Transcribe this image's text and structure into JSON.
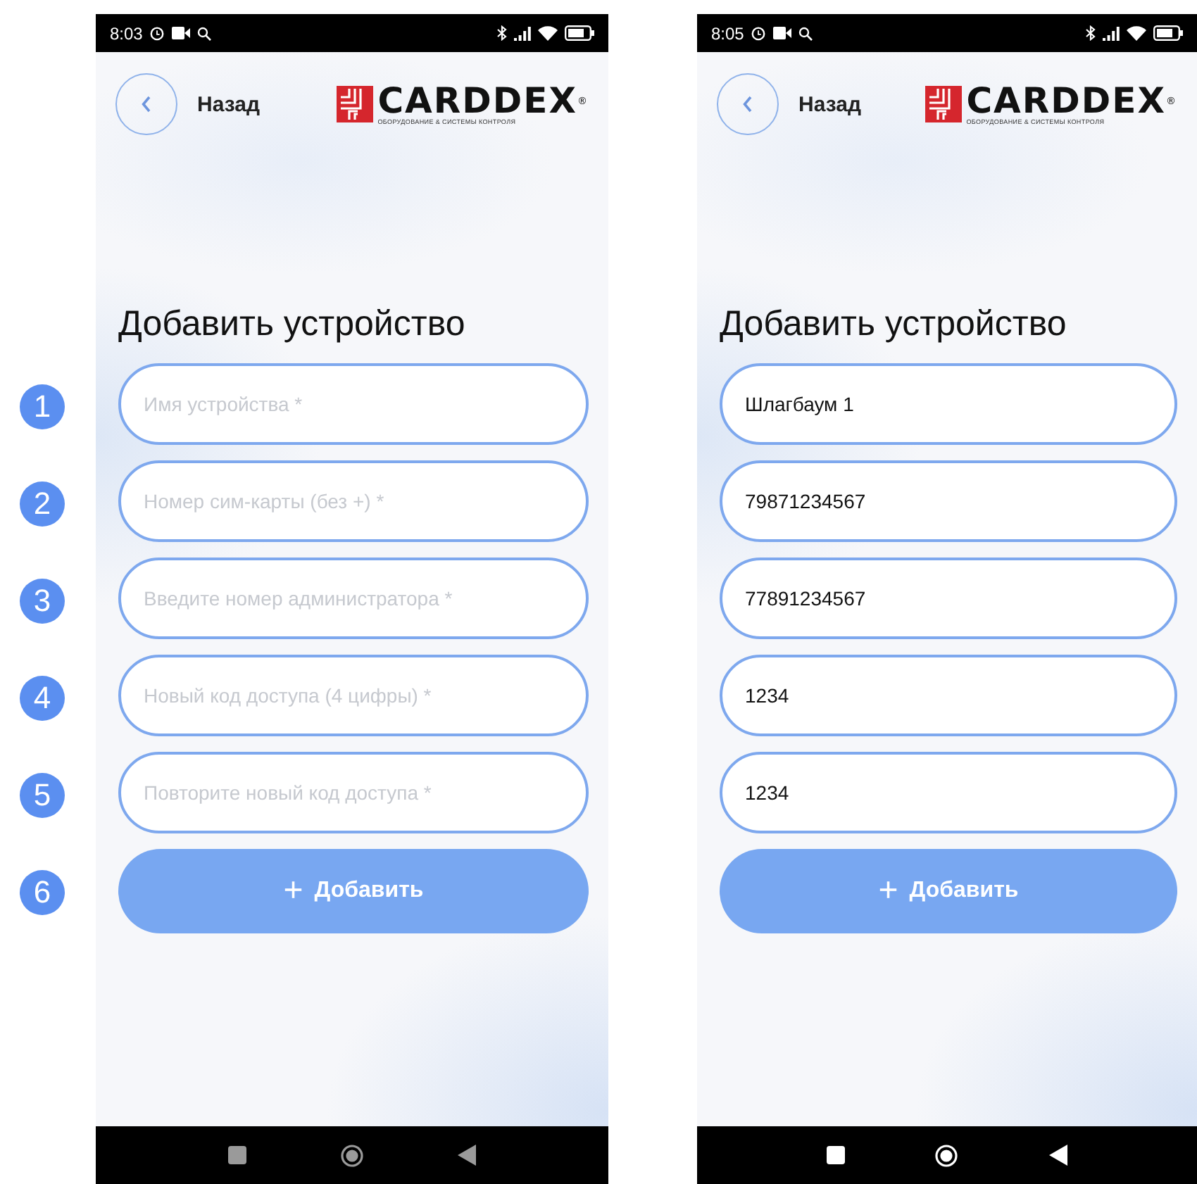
{
  "markers": [
    "1",
    "2",
    "3",
    "4",
    "5",
    "6"
  ],
  "screens": [
    {
      "status_time": "8:03",
      "back_label": "Назад",
      "logo": {
        "name": "CARDDEX",
        "mark": "®",
        "tagline": "ОБОРУДОВАНИЕ & СИСТЕМЫ КОНТРОЛЯ"
      },
      "title": "Добавить устройство",
      "fields": [
        {
          "placeholder": "Имя устройства *"
        },
        {
          "placeholder": "Номер сим-карты (без +) *"
        },
        {
          "placeholder": "Введите номер администратора *"
        },
        {
          "placeholder": "Новый код доступа (4 цифры) *"
        },
        {
          "placeholder": "Повторите новый код доступа *"
        }
      ],
      "button": {
        "icon": "+",
        "label": "Добавить"
      },
      "nav_dimmed": true
    },
    {
      "status_time": "8:05",
      "back_label": "Назад",
      "logo": {
        "name": "CARDDEX",
        "mark": "®",
        "tagline": "ОБОРУДОВАНИЕ & СИСТЕМЫ КОНТРОЛЯ"
      },
      "title": "Добавить устройство",
      "fields": [
        {
          "value": "Шлагбаум 1"
        },
        {
          "value": "79871234567"
        },
        {
          "value": "77891234567"
        },
        {
          "value": "1234"
        },
        {
          "value": "1234"
        }
      ],
      "button": {
        "icon": "+",
        "label": "Добавить"
      },
      "nav_dimmed": false
    }
  ]
}
